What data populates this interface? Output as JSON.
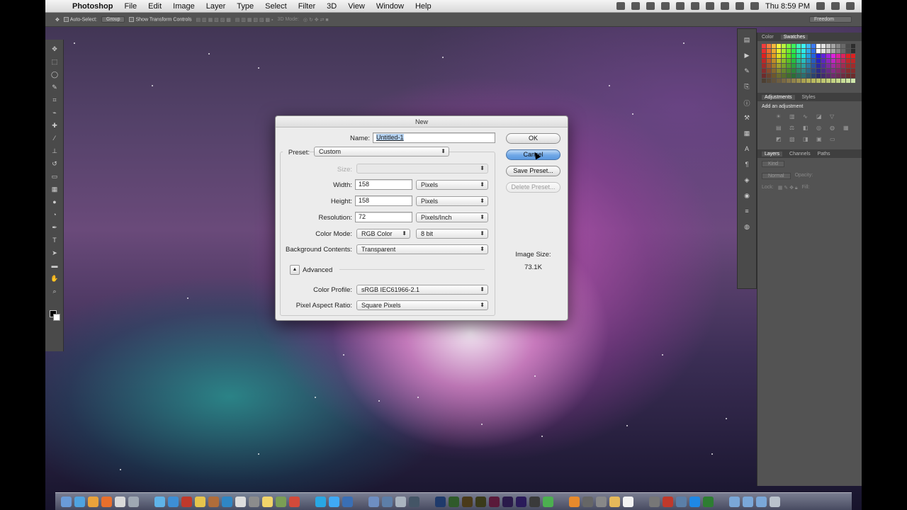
{
  "menubar": {
    "app": "Photoshop",
    "items": [
      "File",
      "Edit",
      "Image",
      "Layer",
      "Type",
      "Select",
      "Filter",
      "3D",
      "View",
      "Window",
      "Help"
    ],
    "clock": "Thu 8:59 PM"
  },
  "optionsbar": {
    "auto_select": "Auto-Select:",
    "group": "Group",
    "show_transform": "Show Transform Controls",
    "mode3d": "3D Mode:",
    "workspace": "Freedom"
  },
  "panels": {
    "top_tabs": [
      "Color",
      "Swatches"
    ],
    "adj_tabs": [
      "Adjustments",
      "Styles"
    ],
    "add_adjustment": "Add an adjustment",
    "layer_tabs": [
      "Layers",
      "Channels",
      "Paths"
    ],
    "kind": "Kind",
    "blend": "Normal",
    "opacity_label": "Opacity:",
    "lock_label": "Lock:",
    "fill_label": "Fill:"
  },
  "dialog": {
    "title": "New",
    "name_label": "Name:",
    "name_value": "Untitled-1",
    "preset_label": "Preset:",
    "preset_value": "Custom",
    "size_label": "Size:",
    "width_label": "Width:",
    "width_value": "158",
    "width_unit": "Pixels",
    "height_label": "Height:",
    "height_value": "158",
    "height_unit": "Pixels",
    "resolution_label": "Resolution:",
    "resolution_value": "72",
    "resolution_unit": "Pixels/Inch",
    "color_mode_label": "Color Mode:",
    "color_mode_value": "RGB Color",
    "bit_depth": "8 bit",
    "bg_label": "Background Contents:",
    "bg_value": "Transparent",
    "advanced_label": "Advanced",
    "profile_label": "Color Profile:",
    "profile_value": "sRGB IEC61966-2.1",
    "aspect_label": "Pixel Aspect Ratio:",
    "aspect_value": "Square Pixels",
    "ok": "OK",
    "cancel": "Cancel",
    "save_preset": "Save Preset...",
    "delete_preset": "Delete Preset...",
    "image_size_label": "Image Size:",
    "image_size_value": "73.1K"
  }
}
